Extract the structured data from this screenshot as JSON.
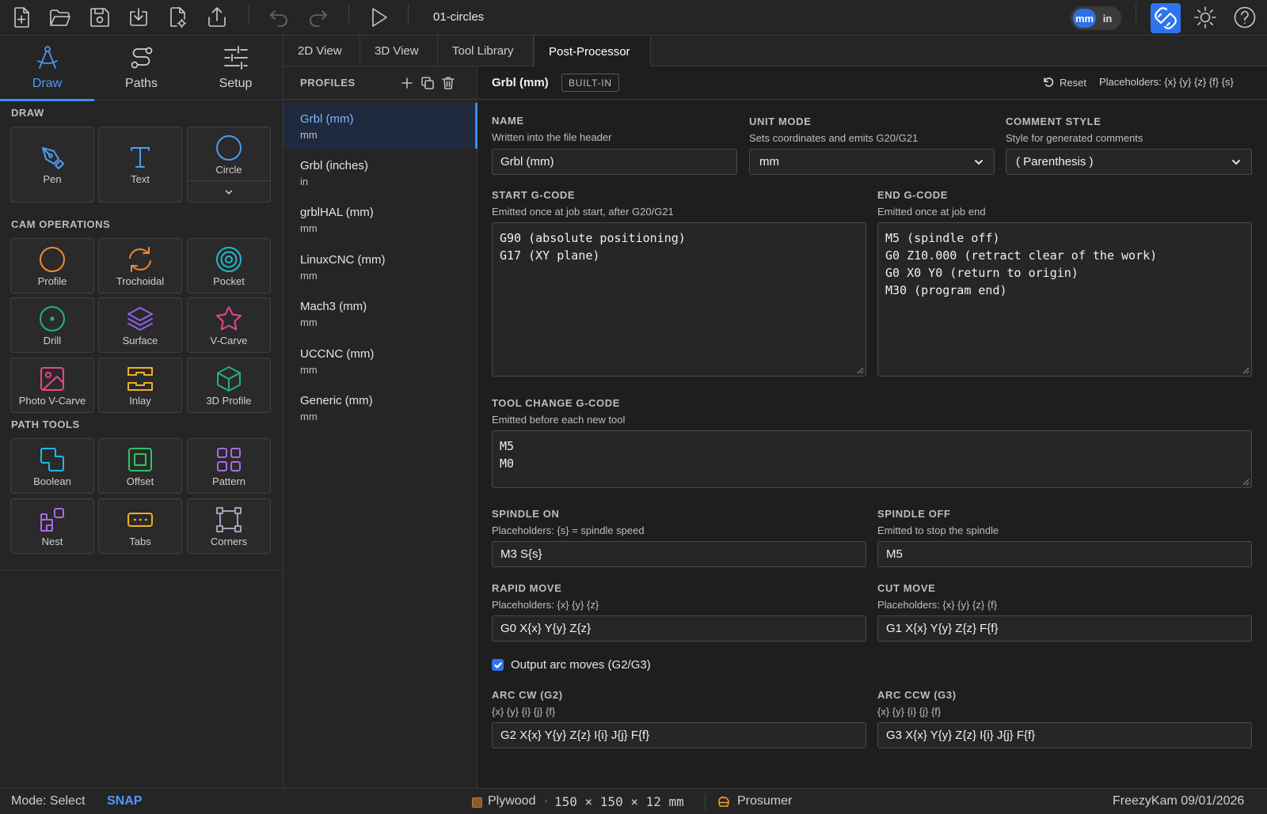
{
  "topbar": {
    "file_name": "01-circles",
    "units": {
      "mm": "mm",
      "in": "in",
      "active": "mm"
    },
    "accent": "#2e74f0"
  },
  "sidebar": {
    "tabs": [
      {
        "label": "Draw",
        "icon": "compass-icon",
        "active": true
      },
      {
        "label": "Paths",
        "icon": "paths-icon"
      },
      {
        "label": "Setup",
        "icon": "sliders-icon"
      }
    ],
    "draw_title": "DRAW",
    "draw_tools": [
      {
        "label": "Pen",
        "icon": "pen-icon"
      },
      {
        "label": "Text",
        "icon": "text-icon"
      },
      {
        "label": "Circle",
        "icon": "circle-icon"
      }
    ],
    "cam_title": "CAM OPERATIONS",
    "cam_tools": [
      {
        "label": "Profile",
        "icon": "profile-icon",
        "color": "#f08a2b"
      },
      {
        "label": "Trochoidal",
        "icon": "trochoidal-icon",
        "color": "#f08a2b"
      },
      {
        "label": "Pocket",
        "icon": "pocket-icon",
        "color": "#22b8cf"
      },
      {
        "label": "Drill",
        "icon": "drill-icon",
        "color": "#20b37a"
      },
      {
        "label": "Surface",
        "icon": "surface-icon",
        "color": "#8f62e8"
      },
      {
        "label": "V-Carve",
        "icon": "star-icon",
        "color": "#e8468e"
      },
      {
        "label": "Photo V-Carve",
        "icon": "photo-icon",
        "color": "#e8468e"
      },
      {
        "label": "Inlay",
        "icon": "inlay-icon",
        "color": "#f0b020"
      },
      {
        "label": "3D Profile",
        "icon": "cube-icon",
        "color": "#20b37a"
      }
    ],
    "path_title": "PATH TOOLS",
    "path_tools": [
      {
        "label": "Boolean",
        "icon": "boolean-icon",
        "color": "#22b8f0"
      },
      {
        "label": "Offset",
        "icon": "offset-icon",
        "color": "#2fc46a"
      },
      {
        "label": "Pattern",
        "icon": "pattern-icon",
        "color": "#a86ae8"
      },
      {
        "label": "Nest",
        "icon": "nest-icon",
        "color": "#a86ae8"
      },
      {
        "label": "Tabs",
        "icon": "tabs-icon",
        "color": "#f0b020"
      },
      {
        "label": "Corners",
        "icon": "corners-icon",
        "color": "#9aa4b8"
      }
    ]
  },
  "main_tabs": [
    "2D View",
    "3D View",
    "Tool Library",
    "Post-Processor"
  ],
  "profiles": {
    "title": "PROFILES",
    "items": [
      {
        "name": "Grbl (mm)",
        "unit": "mm"
      },
      {
        "name": "Grbl (inches)",
        "unit": "in"
      },
      {
        "name": "grblHAL (mm)",
        "unit": "mm"
      },
      {
        "name": "LinuxCNC (mm)",
        "unit": "mm"
      },
      {
        "name": "Mach3 (mm)",
        "unit": "mm"
      },
      {
        "name": "UCCNC (mm)",
        "unit": "mm"
      },
      {
        "name": "Generic (mm)",
        "unit": "mm"
      }
    ]
  },
  "editor": {
    "title": "Grbl (mm)",
    "badge": "BUILT-IN",
    "reset": "Reset",
    "placeholders": "Placeholders: {x} {y} {z} {f} {s}",
    "name": {
      "label": "NAME",
      "help": "Written into the file header",
      "value": "Grbl (mm)"
    },
    "unit_mode": {
      "label": "UNIT MODE",
      "help": "Sets coordinates and emits G20/G21",
      "value": "mm"
    },
    "comment_style": {
      "label": "COMMENT STYLE",
      "help": "Style for generated comments",
      "value": "( Parenthesis )"
    },
    "start": {
      "label": "START G-CODE",
      "help": "Emitted once at job start, after G20/G21",
      "value": "G90 (absolute positioning)\nG17 (XY plane)"
    },
    "end": {
      "label": "END G-CODE",
      "help": "Emitted once at job end",
      "value": "M5 (spindle off)\nG0 Z10.000 (retract clear of the work)\nG0 X0 Y0 (return to origin)\nM30 (program end)"
    },
    "tool_change": {
      "label": "TOOL CHANGE G-CODE",
      "help": "Emitted before each new tool",
      "value": "M5\nM0"
    },
    "spindle_on": {
      "label": "SPINDLE ON",
      "help": "Placeholders: {s} = spindle speed",
      "value": "M3 S{s}"
    },
    "spindle_off": {
      "label": "SPINDLE OFF",
      "help": "Emitted to stop the spindle",
      "value": "M5"
    },
    "rapid": {
      "label": "RAPID MOVE",
      "help": "Placeholders: {x} {y} {z}",
      "value": "G0 X{x} Y{y} Z{z}"
    },
    "cut": {
      "label": "CUT MOVE",
      "help": "Placeholders: {x} {y} {z} {f}",
      "value": "G1 X{x} Y{y} Z{z} F{f}"
    },
    "arcs_checkbox": "Output arc moves (G2/G3)",
    "arc_cw": {
      "label": "ARC CW (G2)",
      "help": "{x} {y} {i} {j} {f}",
      "value": "G2 X{x} Y{y} Z{z} I{i} J{j} F{f}"
    },
    "arc_ccw": {
      "label": "ARC CCW (G3)",
      "help": "{x} {y} {i} {j} {f}",
      "value": "G3 X{x} Y{y} Z{z} I{i} J{j} F{f}"
    }
  },
  "status": {
    "mode": "Mode: Select",
    "snap": "SNAP",
    "material": "Plywood",
    "dims": "150 × 150 × 12 mm",
    "tier": "Prosumer",
    "version": "FreezyKam 09/01/2026"
  }
}
